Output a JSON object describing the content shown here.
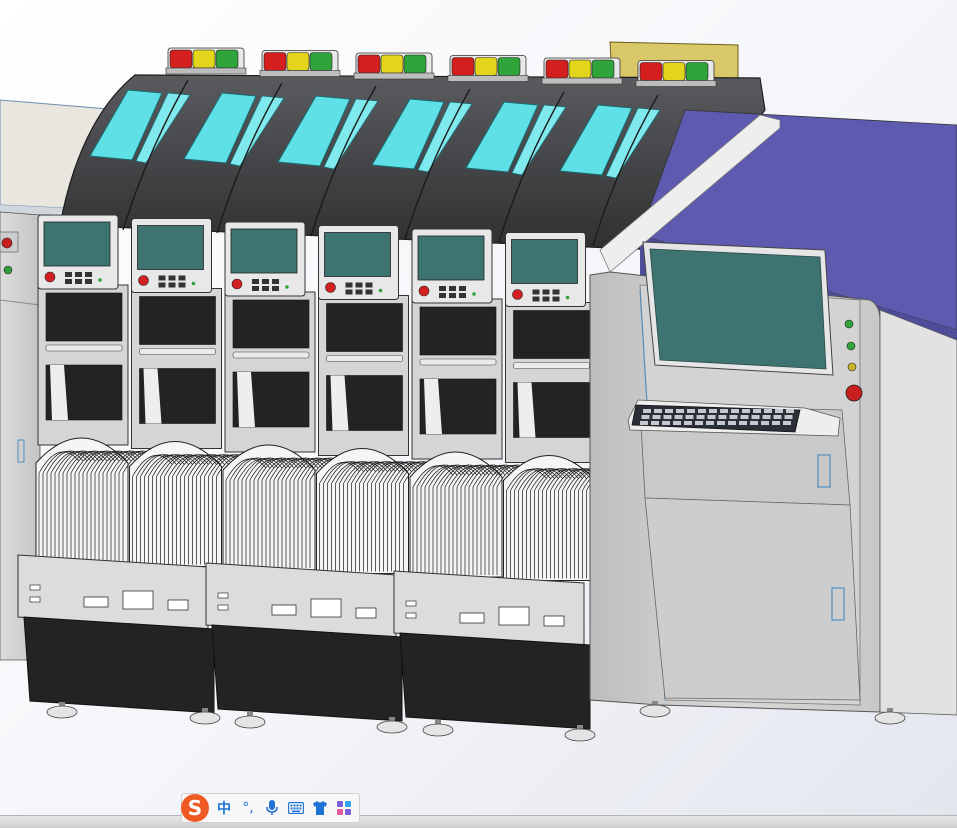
{
  "ime_toolbar": {
    "logo_letter": "S",
    "mode_label": "中",
    "punct_label": "°,",
    "icons": [
      "sogou-logo-icon",
      "microphone-icon",
      "keyboard-icon",
      "skin-shirt-icon",
      "toolbox-grid-icon"
    ]
  },
  "model": {
    "module_count": 6,
    "feeder_base_count": 3,
    "signal_tower_colors": [
      "#d51f1f",
      "#e3d51b",
      "#2ea43a"
    ],
    "colors": {
      "cover_dark": "#4a4b4d",
      "window_cyan": "#5fe0e6",
      "screen_teal": "#3d7471",
      "panel_blue": "#5d5ab0",
      "body_gray": "#d5d5d5",
      "base_dark": "#232323",
      "hmi_frame": "#e8e8e8"
    }
  }
}
